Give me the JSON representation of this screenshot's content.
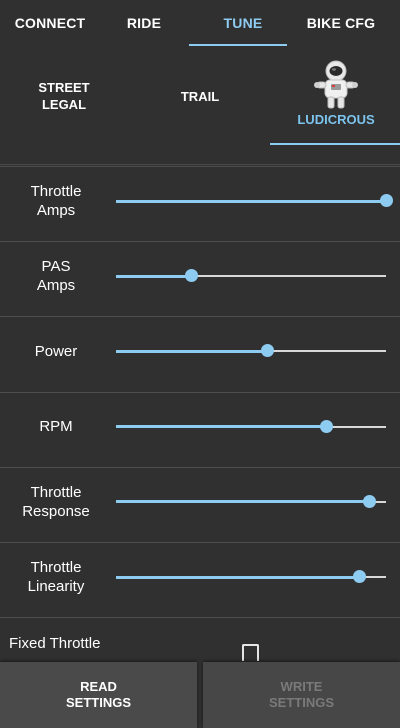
{
  "tabs": [
    {
      "label": "CONNECT",
      "active": false
    },
    {
      "label": "RIDE",
      "active": false
    },
    {
      "label": "TUNE",
      "active": true
    },
    {
      "label": "BIKE CFG",
      "active": false
    }
  ],
  "modes": [
    {
      "label": "STREET\nLEGAL",
      "active": false
    },
    {
      "label": "TRAIL",
      "active": false
    },
    {
      "label": "LUDICROUS",
      "active": true,
      "icon": "astronaut-icon"
    }
  ],
  "sliders": [
    {
      "label": "Throttle\nAmps",
      "value_fraction": 1.0
    },
    {
      "label": "PAS\nAmps",
      "value_fraction": 0.28
    },
    {
      "label": "Power",
      "value_fraction": 0.56
    },
    {
      "label": "RPM",
      "value_fraction": 0.78
    },
    {
      "label": "Throttle\nResponse",
      "value_fraction": 0.94
    },
    {
      "label": "Throttle\nLinearity",
      "value_fraction": 0.9
    }
  ],
  "fixed_throttle": {
    "label": "Fixed Throttle",
    "checked": false
  },
  "buttons": {
    "read": {
      "label": "READ\nSETTINGS",
      "enabled": true
    },
    "write": {
      "label": "WRITE\nSETTINGS",
      "enabled": false
    }
  },
  "colors": {
    "accent": "#8ecbf0",
    "background": "#303030",
    "track": "#d8d8d8"
  }
}
